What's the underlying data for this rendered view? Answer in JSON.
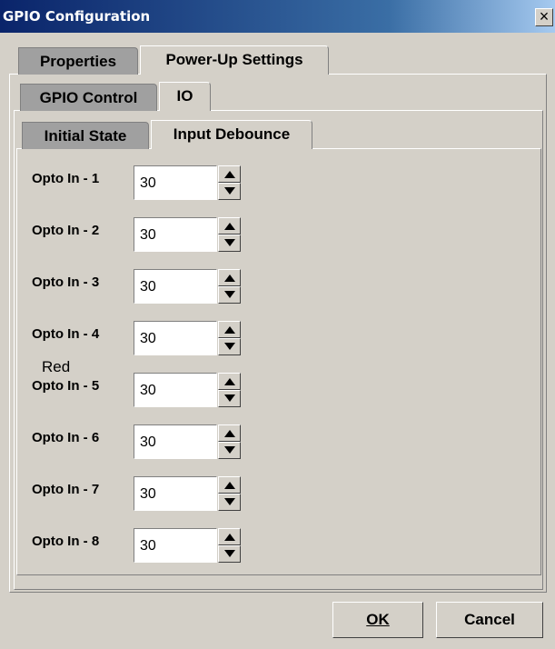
{
  "window": {
    "title": "GPIO Configuration",
    "close_glyph": "×"
  },
  "tabs_level1": [
    {
      "label": "Properties",
      "active": false
    },
    {
      "label": "Power-Up Settings",
      "active": true
    }
  ],
  "tabs_level2": [
    {
      "label": "GPIO Control",
      "active": false
    },
    {
      "label": "IO",
      "active": true
    }
  ],
  "tabs_level3": [
    {
      "label": "Initial State",
      "active": false
    },
    {
      "label": "Input Debounce",
      "active": true
    }
  ],
  "rows": [
    {
      "label": "Opto In - 1",
      "value": "30"
    },
    {
      "label": "Opto In - 2",
      "value": "30"
    },
    {
      "label": "Opto In - 3",
      "value": "30"
    },
    {
      "label": "Opto In - 4",
      "value": "30"
    },
    {
      "label": "Opto In - 5",
      "value": "30"
    },
    {
      "label": "Opto In - 6",
      "value": "30"
    },
    {
      "label": "Opto In - 7",
      "value": "30"
    },
    {
      "label": "Opto In - 8",
      "value": "30"
    }
  ],
  "overlay_text": "Red",
  "buttons": {
    "ok": "OK",
    "cancel": "Cancel"
  },
  "icons": {
    "close": "close-icon",
    "spin_up": "triangle-up-icon",
    "spin_down": "triangle-down-icon"
  }
}
